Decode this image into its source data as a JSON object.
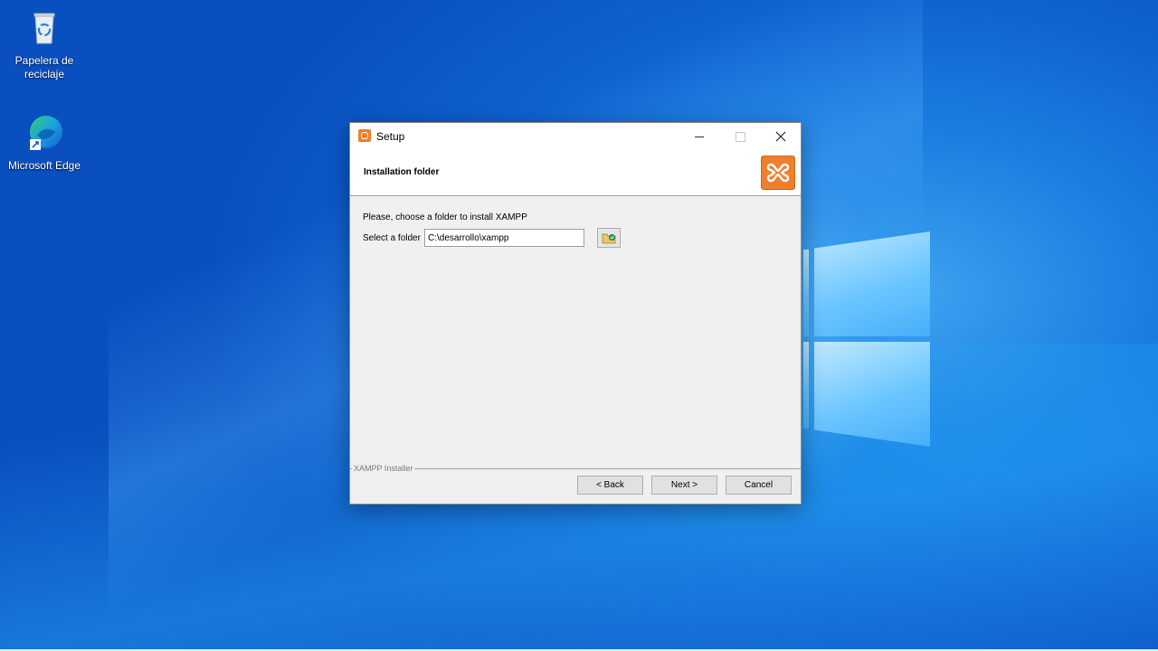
{
  "desktop": {
    "icons": [
      {
        "label": "Papelera de reciclaje",
        "icon": "recycle-bin-icon"
      },
      {
        "label": "Microsoft Edge",
        "icon": "edge-icon"
      }
    ]
  },
  "dialog": {
    "title": "Setup",
    "window_controls": {
      "minimize": "minimize-icon",
      "maximize": "maximize-icon",
      "close": "close-icon"
    },
    "header_title": "Installation folder",
    "prompt": "Please, choose a folder to install XAMPP",
    "folder_label": "Select a folder",
    "folder_value": "C:\\desarrollo\\xampp",
    "footer_label": "XAMPP Installer",
    "buttons": {
      "back": "< Back",
      "next": "Next >",
      "cancel": "Cancel"
    }
  },
  "colors": {
    "accent": "#f07f2c",
    "desktop_blue": "#0f62d0"
  }
}
